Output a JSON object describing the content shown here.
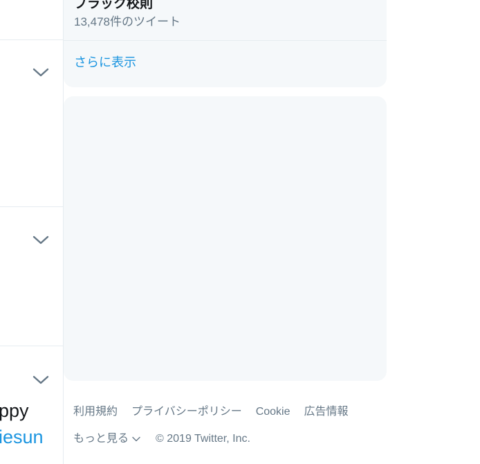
{
  "timeline": {
    "tweet_text_1": "ppy",
    "tweet_text_2": "iesun"
  },
  "trends": {
    "name": "ブラック校則",
    "count": "13,478件のツイート",
    "show_more": "さらに表示"
  },
  "footer": {
    "links": [
      "利用規約",
      "プライバシーポリシー",
      "Cookie",
      "広告情報"
    ],
    "more": "もっと見る",
    "copyright": "© 2019 Twitter, Inc."
  },
  "colors": {
    "link": "#1b95e0",
    "muted": "#657786",
    "card_bg": "#f5f8fa",
    "border": "#e6ecf0"
  },
  "icons": {
    "tweet_menu": "chevron-down-icon",
    "more_menu": "chevron-down-icon"
  }
}
